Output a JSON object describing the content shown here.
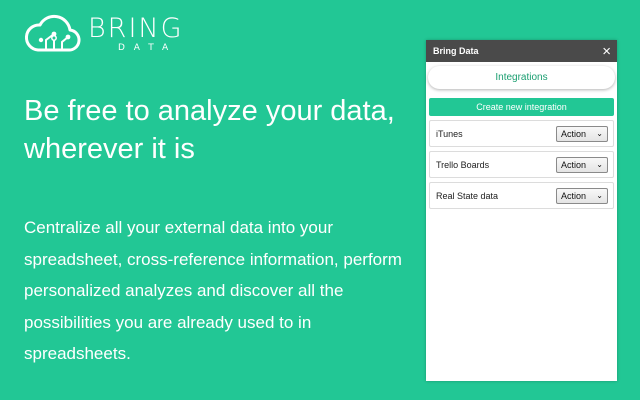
{
  "logo": {
    "word": "BRING",
    "sub": "DATA",
    "icon": "cloud-circuit-icon"
  },
  "hero": {
    "headline": "Be free to analyze your data, wherever it is",
    "body": "Centralize all your external data into your spreadsheet, cross-reference information, perform personalized analyzes and discover all the possibilities you are already used to in spreadsheets."
  },
  "panel": {
    "title": "Bring Data",
    "close_icon": "×",
    "tab_label": "Integrations",
    "create_label": "Create new integration",
    "items": [
      {
        "name": "iTunes",
        "action": "Action"
      },
      {
        "name": "Trello Boards",
        "action": "Action"
      },
      {
        "name": "Real State data",
        "action": "Action"
      }
    ]
  },
  "colors": {
    "background": "#22c795",
    "header": "#4a4a4a",
    "accent_text": "#1a9e70"
  }
}
